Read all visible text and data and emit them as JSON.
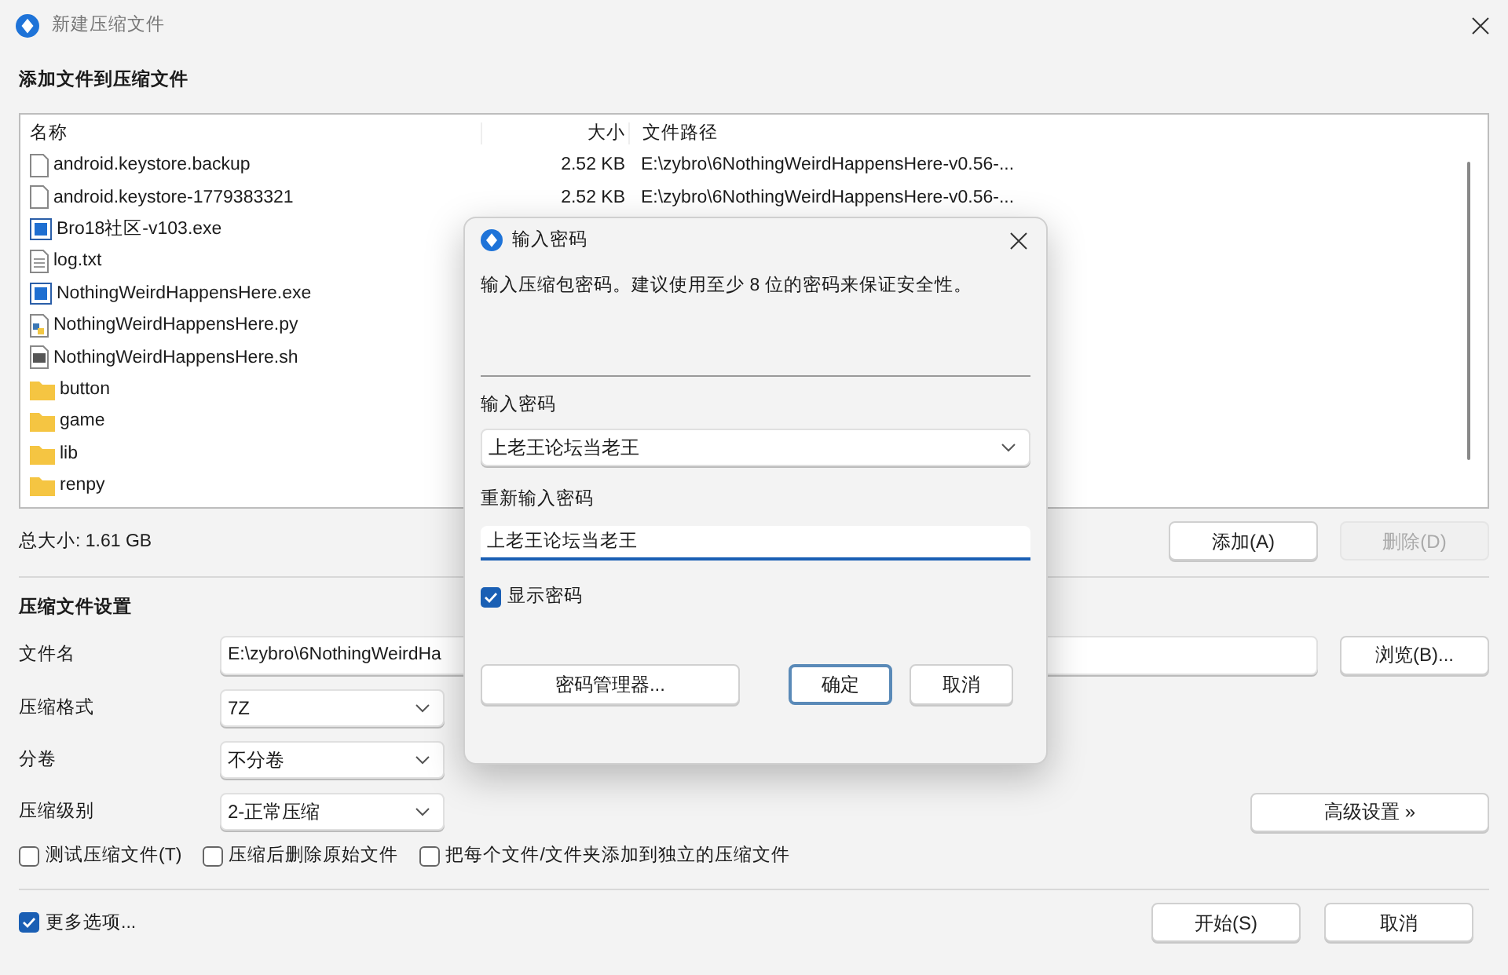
{
  "window": {
    "title": "新建压缩文件"
  },
  "add_section": {
    "title": "添加文件到压缩文件"
  },
  "file_list": {
    "columns": [
      "名称",
      "大小",
      "文件路径"
    ],
    "rows": [
      {
        "kind": "file",
        "name": "android.keystore.backup",
        "size": "2.52 KB",
        "path": "E:\\zybro\\6NothingWeirdHappensHere-v0.56-..."
      },
      {
        "kind": "file",
        "name": "android.keystore-1779383321",
        "size": "2.52 KB",
        "path": "E:\\zybro\\6NothingWeirdHappensHere-v0.56-..."
      },
      {
        "kind": "exe",
        "name": "Bro18社区-v103.exe"
      },
      {
        "kind": "text",
        "name": "log.txt"
      },
      {
        "kind": "exe",
        "name": "NothingWeirdHappensHere.exe"
      },
      {
        "kind": "script",
        "name": "NothingWeirdHappensHere.py"
      },
      {
        "kind": "shell",
        "name": "NothingWeirdHappensHere.sh"
      },
      {
        "kind": "folder",
        "name": "button"
      },
      {
        "kind": "folder",
        "name": "game"
      },
      {
        "kind": "folder",
        "name": "lib"
      },
      {
        "kind": "folder",
        "name": "renpy"
      }
    ]
  },
  "total_size": "总大小: 1.61 GB",
  "list_buttons": [
    {
      "label": "添加(A)",
      "disabled": false
    },
    {
      "label": "删除(D)",
      "disabled": true
    }
  ],
  "settings": {
    "title": "压缩文件设置",
    "filename": {
      "label": "文件名",
      "value": "E:\\zybro\\6NothingWeirdHa"
    },
    "browse_button": "浏览(B)...",
    "format": {
      "label": "压缩格式",
      "value": "7Z"
    },
    "split": {
      "label": "分卷",
      "value": "不分卷"
    },
    "level": {
      "label": "压缩级别",
      "value": "2-正常压缩"
    },
    "advanced_button": "高级设置 »",
    "options": [
      {
        "label": "测试压缩文件(T)",
        "checked": false
      },
      {
        "label": "压缩后删除原始文件",
        "checked": false
      },
      {
        "label": "把每个文件/文件夹添加到独立的压缩文件",
        "checked": false
      }
    ]
  },
  "more_options": {
    "label": "更多选项...",
    "checked": true
  },
  "footer_buttons": [
    "开始(S)",
    "取消"
  ],
  "password_dialog": {
    "title": "输入密码",
    "description": "输入压缩包密码。建议使用至少 8 位的密码来保证安全性。",
    "password": {
      "label": "输入密码",
      "value": "上老王论坛当老王"
    },
    "confirm": {
      "label": "重新输入密码",
      "value": "上老王论坛当老王"
    },
    "show_password": {
      "label": "显示密码",
      "checked": true
    },
    "buttons": [
      {
        "label": "密码管理器...",
        "default": false
      },
      {
        "label": "确定",
        "default": true
      },
      {
        "label": "取消",
        "default": false
      }
    ]
  }
}
